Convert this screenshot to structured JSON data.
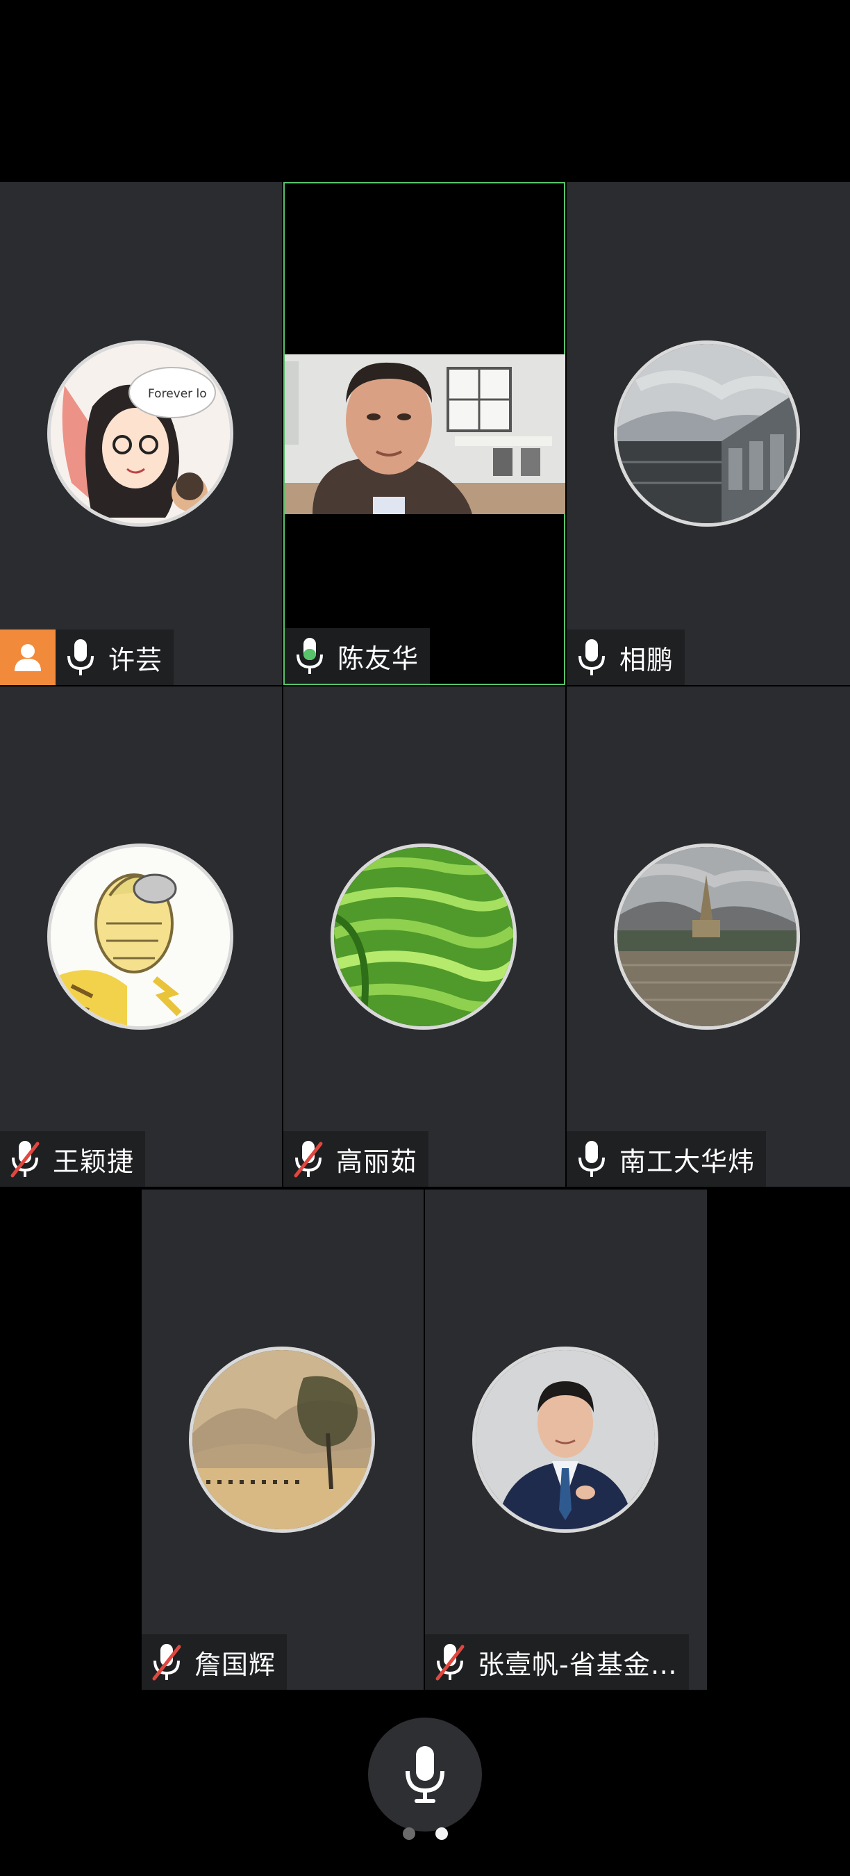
{
  "participants": [
    {
      "name": "许芸",
      "mic": "on",
      "host": true,
      "avatar_text": "Forever lo"
    },
    {
      "name": "陈友华",
      "mic": "speaking",
      "video": true
    },
    {
      "name": "相鹏",
      "mic": "on"
    },
    {
      "name": "王颖捷",
      "mic": "muted"
    },
    {
      "name": "高丽茹",
      "mic": "muted"
    },
    {
      "name": "南工大华炜",
      "mic": "on"
    },
    {
      "name": "詹国辉",
      "mic": "muted"
    },
    {
      "name": "张壹帆-省基金…",
      "mic": "muted"
    }
  ],
  "pagination": {
    "pages": 2,
    "current": 2
  },
  "colors": {
    "active_border": "#58c36a",
    "host_badge": "#f28a3b",
    "tile_bg": "#2b2c2f"
  }
}
